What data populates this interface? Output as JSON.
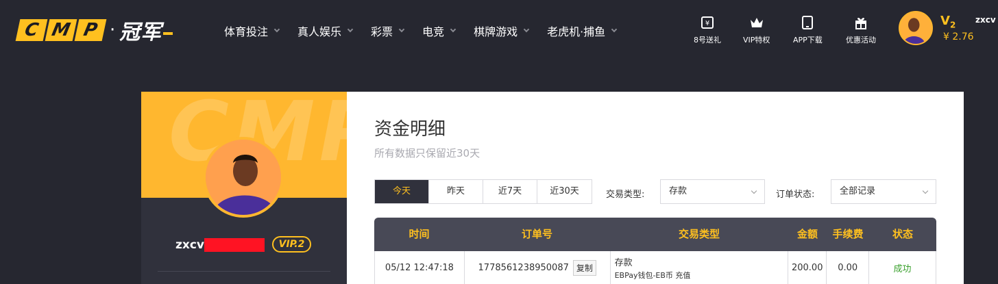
{
  "brand": {
    "letters": [
      "C",
      "M",
      "P"
    ],
    "dot": "·",
    "cn_name": "冠军"
  },
  "nav": [
    {
      "label": "体育投注"
    },
    {
      "label": "真人娱乐"
    },
    {
      "label": "彩票"
    },
    {
      "label": "电竞"
    },
    {
      "label": "棋牌游戏"
    },
    {
      "label": "老虎机·捕鱼"
    }
  ],
  "quick_links": [
    {
      "label": "8号送礼",
      "icon": "ticket-icon"
    },
    {
      "label": "VIP特权",
      "icon": "crown-icon"
    },
    {
      "label": "APP下载",
      "icon": "tablet-icon"
    },
    {
      "label": "优惠活动",
      "icon": "gift-icon"
    }
  ],
  "account": {
    "vip_level_prefix": "V",
    "vip_level_num": "2",
    "username": "zxcv",
    "balance": "¥ 2.76"
  },
  "side": {
    "watermark": "CMP",
    "username": "zxcv",
    "vip_badge": "VIP.2"
  },
  "main": {
    "title": "资金明细",
    "subtitle": "所有数据只保留近30天",
    "date_tabs": [
      {
        "label": "今天",
        "active": true
      },
      {
        "label": "昨天",
        "active": false
      },
      {
        "label": "近7天",
        "active": false
      },
      {
        "label": "近30天",
        "active": false
      }
    ],
    "filter_type_label": "交易类型:",
    "filter_type_value": "存款",
    "filter_status_label": "订单状态:",
    "filter_status_value": "全部记录",
    "table": {
      "headers": [
        "时间",
        "订单号",
        "交易类型",
        "金额",
        "手续费",
        "状态"
      ],
      "rows": [
        {
          "time": "05/12 12:47:18",
          "order_no": "1778561238950087",
          "copy_label": "复制",
          "type_main": "存款",
          "type_detail": "EBPay钱包-EB币 充值",
          "amount": "200.00",
          "fee": "0.00",
          "status": "成功"
        }
      ]
    }
  },
  "colors": {
    "accent": "#ffc01f",
    "bg": "#262730",
    "panel": "#30313c",
    "success": "#3aa02d"
  }
}
